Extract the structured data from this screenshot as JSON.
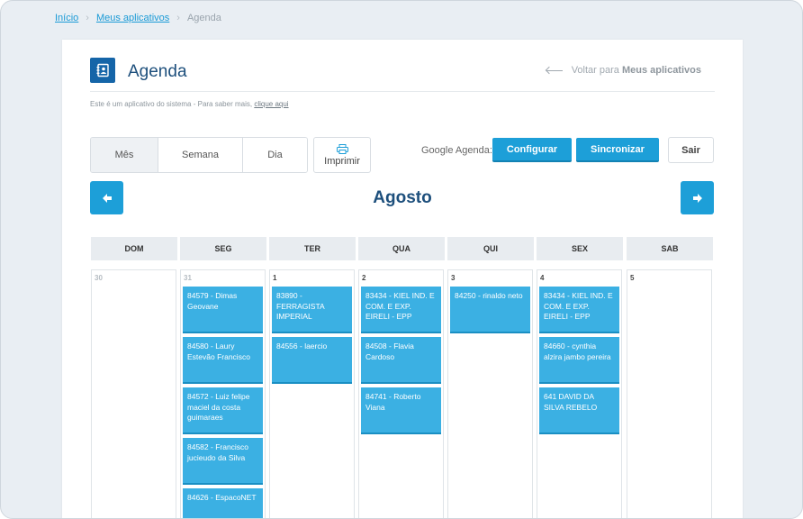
{
  "breadcrumb": {
    "home": "Início",
    "apps": "Meus aplicativos",
    "current": "Agenda"
  },
  "header": {
    "title": "Agenda",
    "back_prefix": "Voltar para",
    "back_target": "Meus aplicativos",
    "info_text": "Este é um aplicativo do sistema - Para saber mais,",
    "info_link": "clique aqui",
    "icon": "contacts-book-icon"
  },
  "toolbar": {
    "views": [
      "Mês",
      "Semana",
      "Dia"
    ],
    "active_view": "Mês",
    "print_label": "Imprimir",
    "google_label": "Google Agenda:",
    "configure_label": "Configurar",
    "sync_label": "Sincronizar",
    "exit_label": "Sair"
  },
  "calendar": {
    "month": "Agosto",
    "weekdays": [
      "DOM",
      "SEG",
      "TER",
      "QUA",
      "QUI",
      "SEX",
      "SAB"
    ],
    "days": [
      {
        "num": "30",
        "muted": true,
        "events": []
      },
      {
        "num": "31",
        "muted": true,
        "events": [
          "84579 - Dimas Geovane",
          "84580 - Laury Estevão Francisco",
          "84572 - Luiz felipe maciel da costa guimaraes",
          "84582 - Francisco jucieudo da Silva",
          "84626 - EspacoNET"
        ]
      },
      {
        "num": "1",
        "muted": false,
        "events": [
          "83890 - FERRAGISTA IMPERIAL",
          "84556 - laercio"
        ]
      },
      {
        "num": "2",
        "muted": false,
        "events": [
          "83434 - KIEL IND. E COM. E EXP. EIRELI - EPP",
          "84508 - Flavia Cardoso",
          "84741 - Roberto Viana"
        ]
      },
      {
        "num": "3",
        "muted": false,
        "events": [
          "84250 - rinaldo neto"
        ]
      },
      {
        "num": "4",
        "muted": false,
        "events": [
          "83434 - KIEL IND. E COM. E EXP. EIRELI - EPP",
          "84660 - cynthia alzira jambo pereira",
          "641 DAVID DA SILVA REBELO"
        ]
      },
      {
        "num": "5",
        "muted": false,
        "events": []
      }
    ]
  },
  "colors": {
    "accent": "#1d9fd8",
    "event": "#3bb0e3",
    "title": "#1d4f7c"
  }
}
